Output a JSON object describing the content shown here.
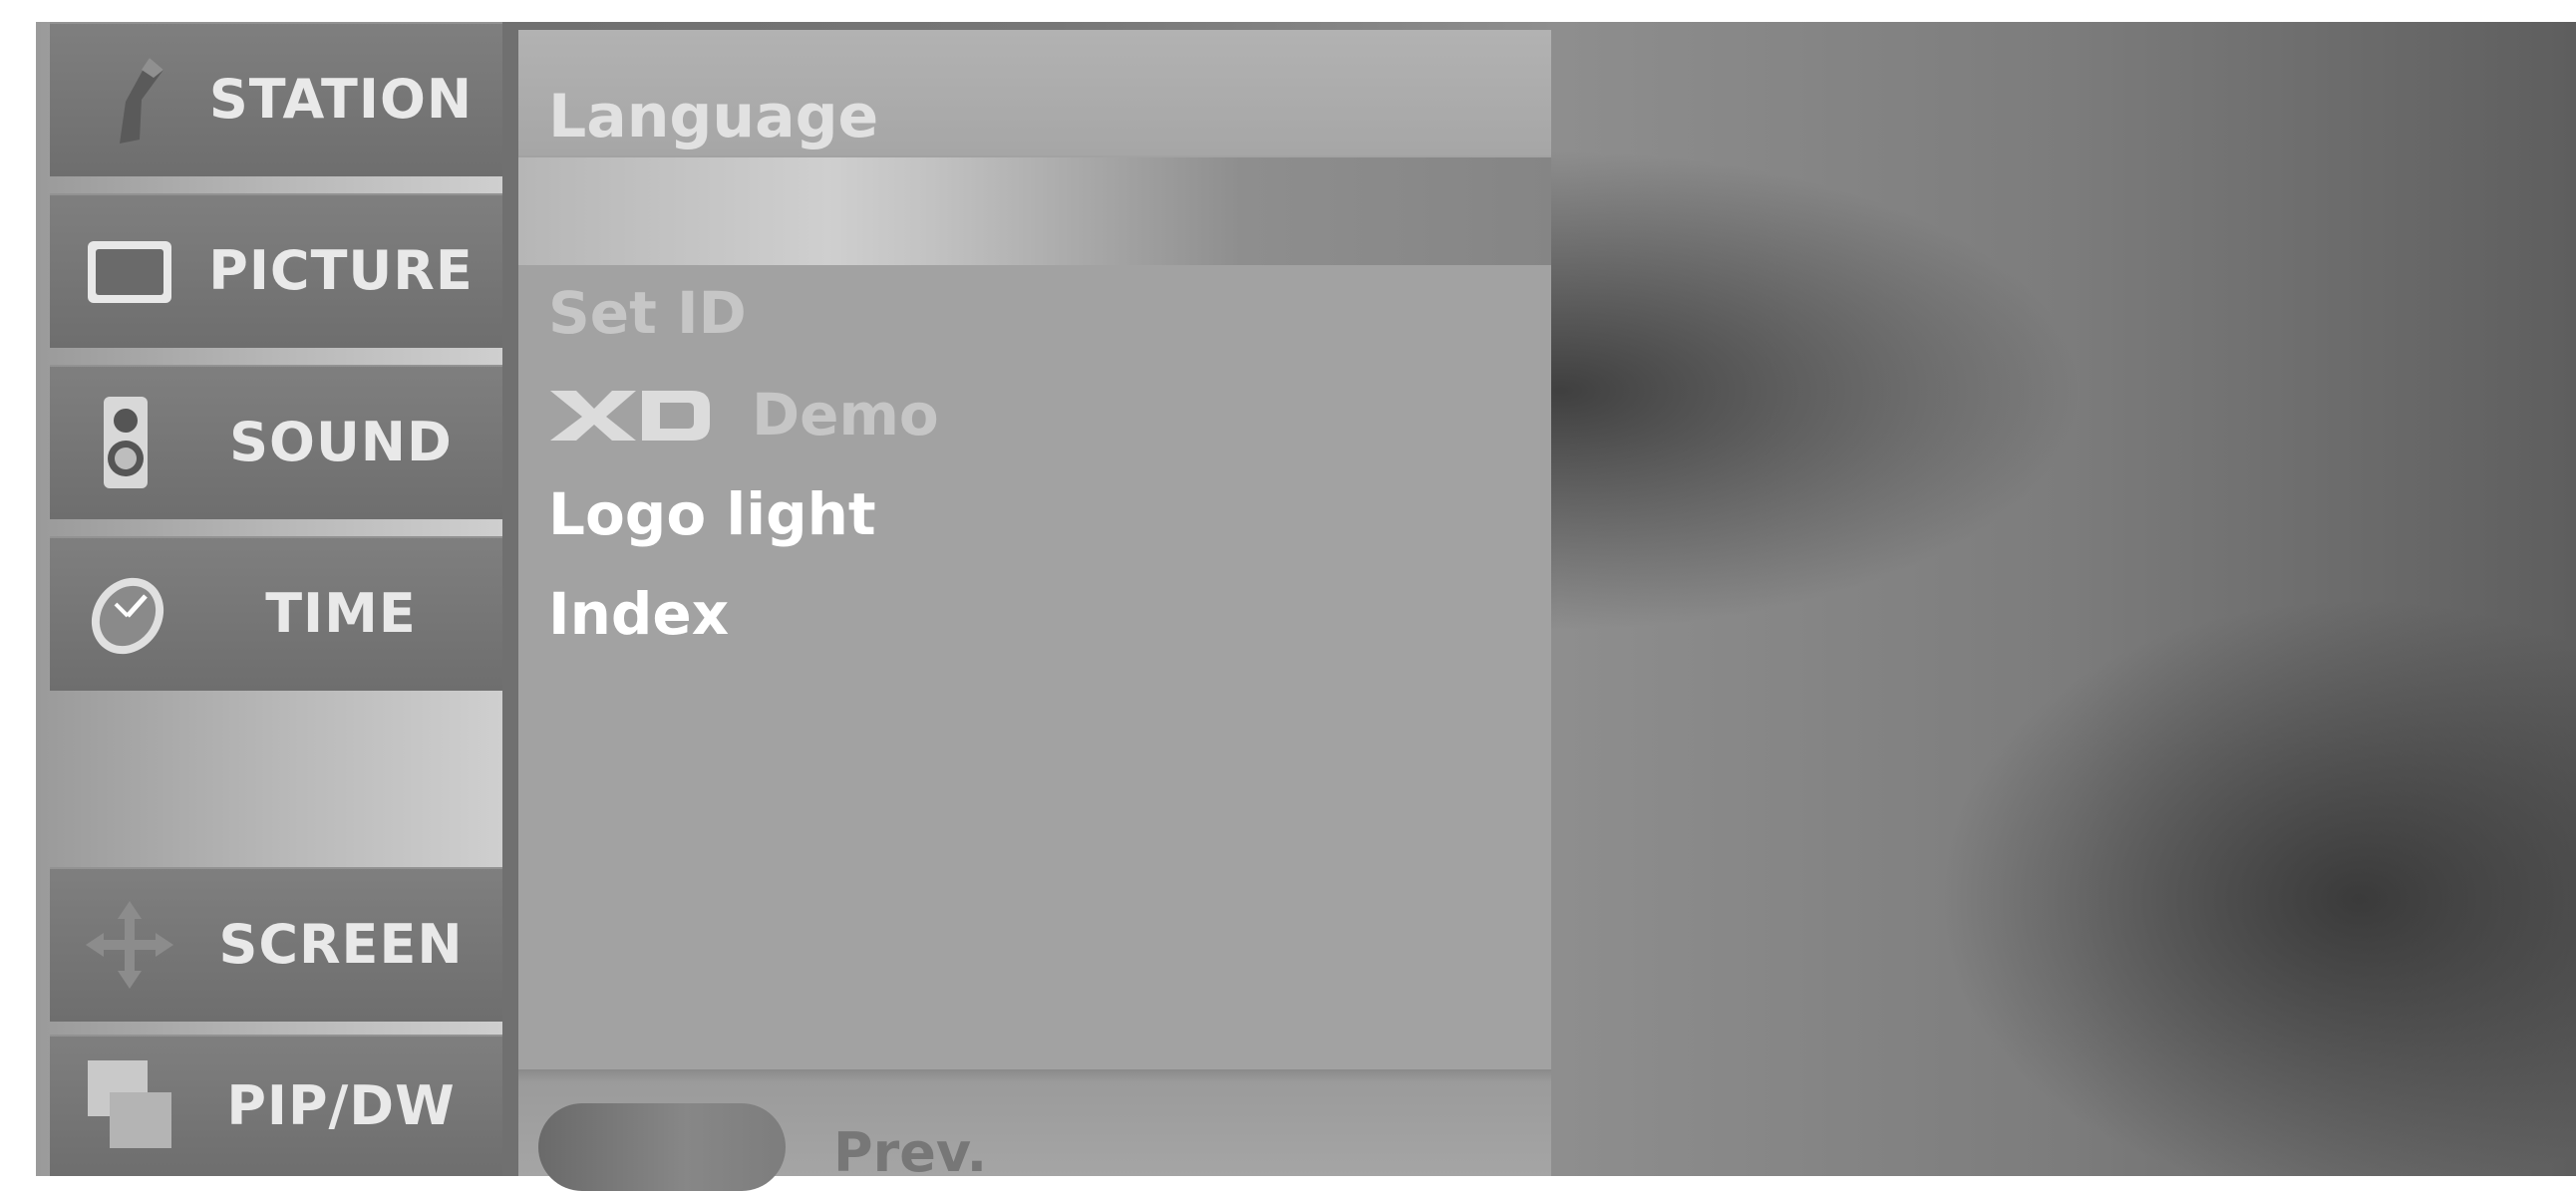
{
  "sidebar": {
    "items": [
      {
        "label": "STATION",
        "icon": "antenna-icon"
      },
      {
        "label": "PICTURE",
        "icon": "monitor-icon"
      },
      {
        "label": "SOUND",
        "icon": "speaker-icon"
      },
      {
        "label": "TIME",
        "icon": "clock-icon"
      },
      {
        "label": "SCREEN",
        "icon": "move-arrows-icon"
      },
      {
        "label": "PIP/DW",
        "icon": "pip-windows-icon"
      }
    ]
  },
  "panel": {
    "title": "Language",
    "options": [
      {
        "label": "Set ID",
        "state": "dim"
      },
      {
        "label": "Demo",
        "prefix_logo": "XD",
        "state": "dim"
      },
      {
        "label": "Logo light",
        "state": "bright"
      },
      {
        "label": "Index",
        "state": "bright"
      }
    ],
    "footer": {
      "prev_label": "Prev."
    }
  }
}
